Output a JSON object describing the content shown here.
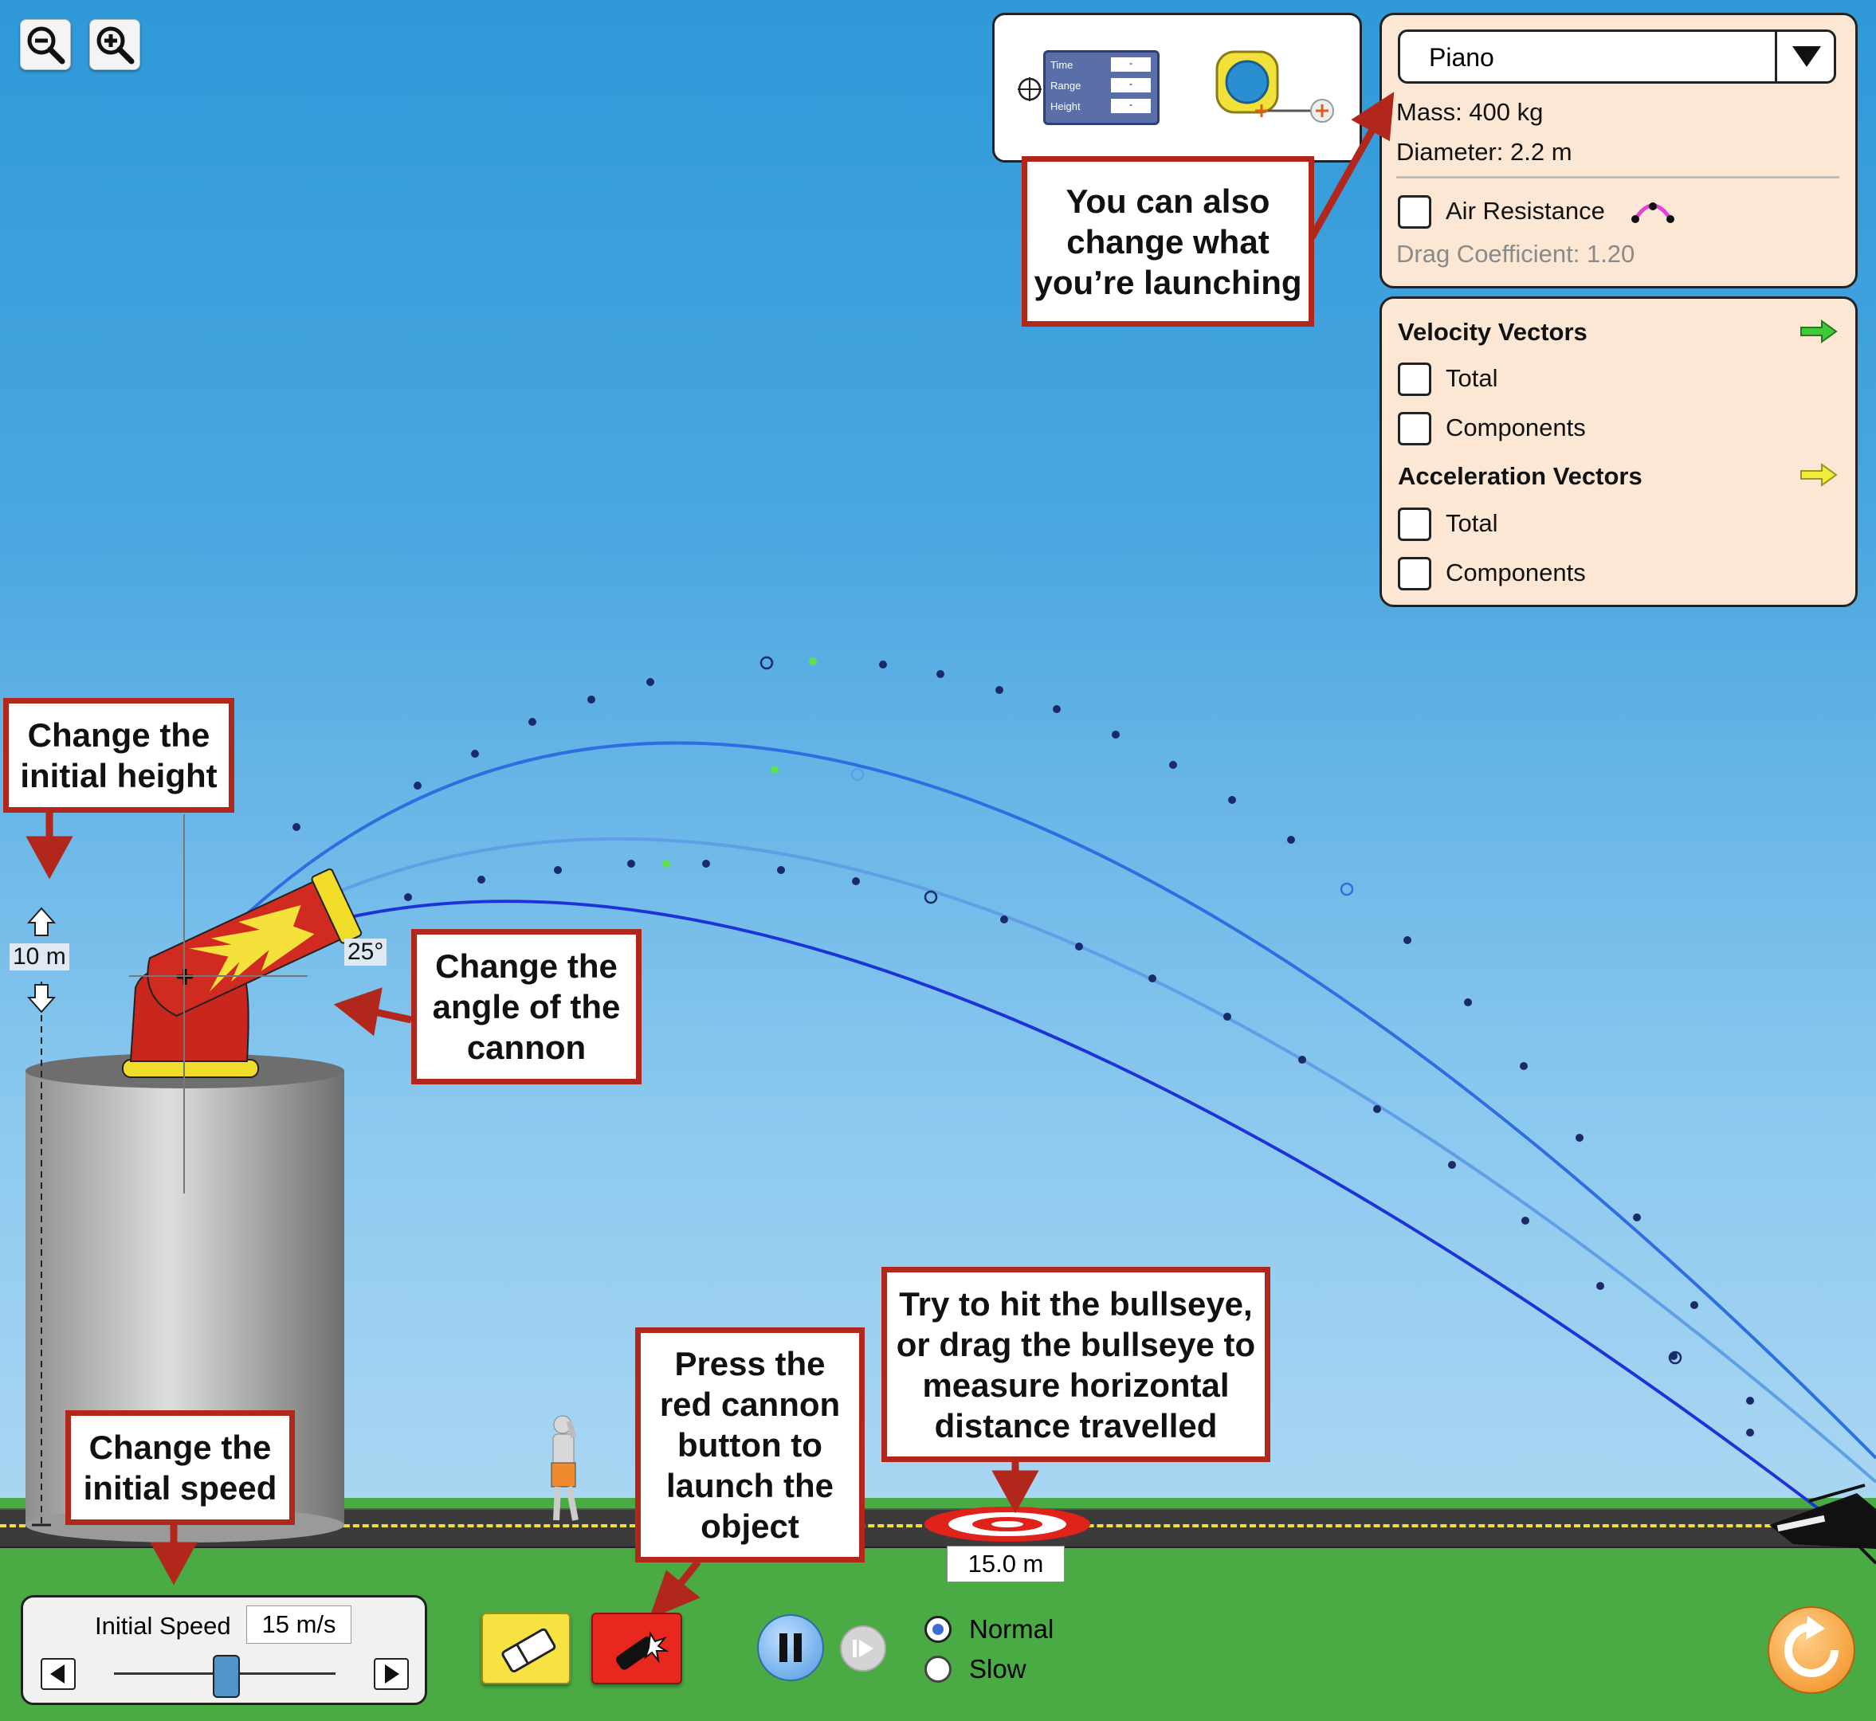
{
  "zoom": {
    "zoom_out_icon": "zoom-out-icon",
    "zoom_in_icon": "zoom-in-icon"
  },
  "tools": {
    "readout_rows": [
      "Time",
      "Range",
      "Height"
    ],
    "readout_values": [
      "-",
      "-",
      "-"
    ]
  },
  "projectile": {
    "selected": "Piano",
    "mass": "Mass: 400 kg",
    "diameter": "Diameter: 2.2 m",
    "air_resistance_label": "Air Resistance",
    "air_resistance_checked": false,
    "drag_coefficient": "Drag Coefficient: 1.20"
  },
  "vectors": {
    "velocity_title": "Velocity Vectors",
    "velocity_total": "Total",
    "velocity_components": "Components",
    "acceleration_title": "Acceleration Vectors",
    "acceleration_total": "Total",
    "acceleration_components": "Components",
    "velocity_arrow_color": "#3fc93c",
    "acceleration_arrow_color": "#f2ec3c"
  },
  "cannon": {
    "height_label": "10 m",
    "angle_label": "25°"
  },
  "target": {
    "distance_label": "15.0 m"
  },
  "speed_control": {
    "label": "Initial Speed",
    "value": "15 m/s",
    "slider_fraction": 0.5
  },
  "playback": {
    "normal_label": "Normal",
    "slow_label": "Slow",
    "selected": "Normal"
  },
  "callouts": {
    "launching": [
      "You can also",
      "change what",
      "you’re launching"
    ],
    "height": [
      "Change the",
      "initial height"
    ],
    "angle": [
      "Change the",
      "angle of the",
      "cannon"
    ],
    "speed": [
      "Change the",
      "initial speed"
    ],
    "launch": [
      "Press the",
      "red cannon",
      "button to",
      "launch the",
      "object"
    ],
    "bullseye": [
      "Try to hit the bullseye,",
      "or drag the bullseye to",
      "measure horizontal",
      "distance travelled"
    ]
  },
  "colors": {
    "callout_border": "#b1271c",
    "panel_bg": "#fbe7d3",
    "reset": "#f39a2a"
  }
}
